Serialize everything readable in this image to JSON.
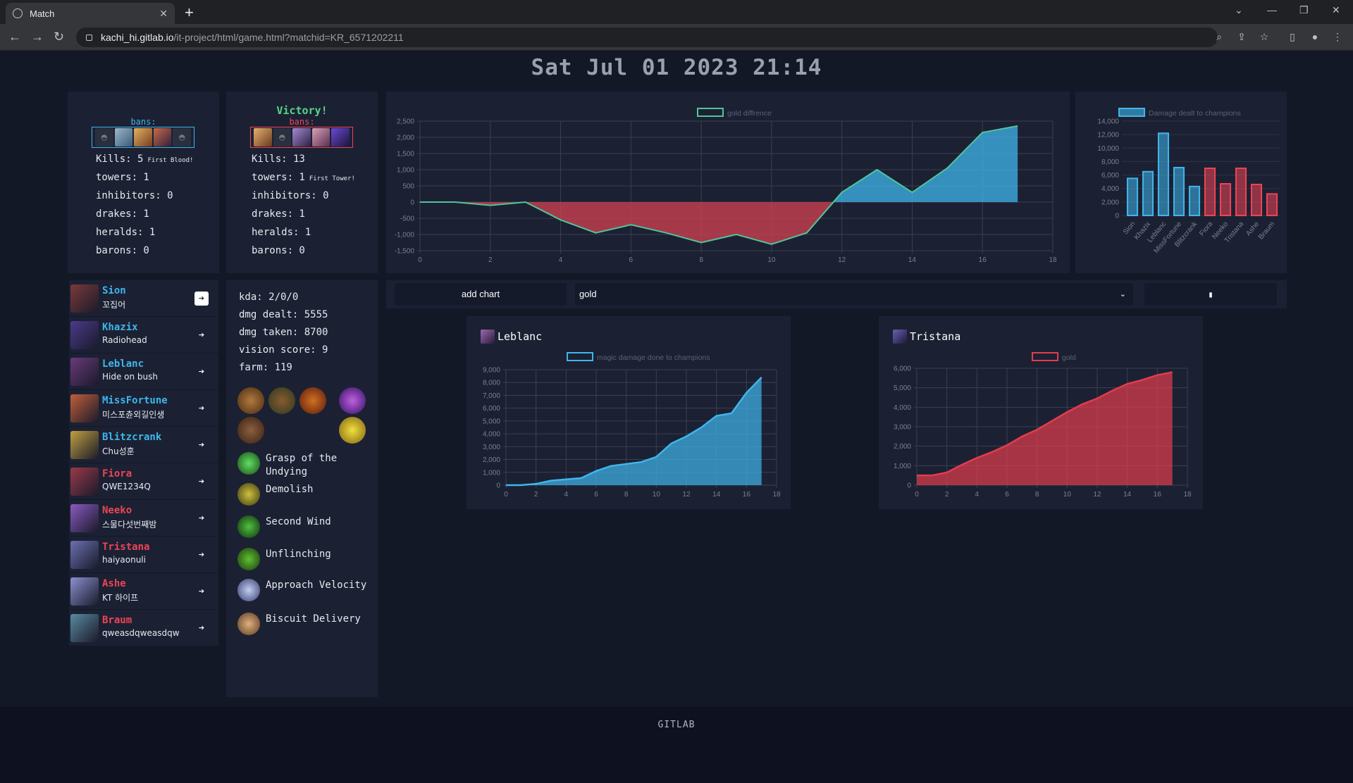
{
  "browser": {
    "tab_title": "Match",
    "url_host": "kachi_hi.gitlab.io",
    "url_path": "/it-project/html/game.html?matchid=KR_6571202211"
  },
  "page": {
    "title": "Sat Jul 01 2023 21:14",
    "footer": "GITLAB"
  },
  "teams": {
    "blue": {
      "bans_label": "bans:",
      "kills_label": "Kills: 5",
      "kills_note": "First Blood!",
      "towers": "towers: 1",
      "inhibitors": "inhibitors: 0",
      "drakes": "drakes: 1",
      "heralds": "heralds: 1",
      "barons": "barons: 0",
      "color": "#3fb6ec"
    },
    "red": {
      "result": "Victory!",
      "bans_label": "bans:",
      "kills_label": "Kills: 13",
      "towers": "towers: 1",
      "towers_note": "First Tower!",
      "inhibitors": "inhibitors: 0",
      "drakes": "drakes: 1",
      "heralds": "heralds: 1",
      "barons": "barons: 0",
      "color": "#ee4455"
    }
  },
  "players": [
    {
      "champion": "Sion",
      "player": "꼬집어",
      "team": "blue",
      "selected": true
    },
    {
      "champion": "Khazix",
      "player": "Radiohead",
      "team": "blue"
    },
    {
      "champion": "Leblanc",
      "player": "Hide on bush",
      "team": "blue"
    },
    {
      "champion": "MissFortune",
      "player": "미스포츈외길인생",
      "team": "blue"
    },
    {
      "champion": "Blitzcrank",
      "player": "Chu성훈",
      "team": "blue"
    },
    {
      "champion": "Fiora",
      "player": "QWE1234Q",
      "team": "red"
    },
    {
      "champion": "Neeko",
      "player": "스물다섯번째밤",
      "team": "red"
    },
    {
      "champion": "Tristana",
      "player": "haiyaonuli",
      "team": "red"
    },
    {
      "champion": "Ashe",
      "player": "KT 하이프",
      "team": "red"
    },
    {
      "champion": "Braum",
      "player": "qweasdqweasdqw",
      "team": "red"
    }
  ],
  "arrow_glyph": "➔",
  "selected_stats": {
    "kda": "kda: 2/0/0",
    "dmg_dealt": "dmg dealt: 5555",
    "dmg_taken": "dmg taken: 8700",
    "vision": "vision score: 9",
    "farm": "farm: 119",
    "runes": [
      "Grasp of the Undying",
      "Demolish",
      "Second Wind",
      "Unflinching",
      "Approach Velocity",
      "Biscuit Delivery"
    ]
  },
  "controls": {
    "add_chart": "add chart",
    "select_value": "gold",
    "caret": "⌄",
    "delete": "▮"
  },
  "chart_data": [
    {
      "type": "area",
      "legend": "gold diffrence",
      "x": [
        0,
        1,
        2,
        3,
        4,
        5,
        6,
        7,
        8,
        9,
        10,
        11,
        12,
        13,
        14,
        15,
        16,
        17
      ],
      "values": [
        0,
        0,
        -100,
        0,
        -550,
        -950,
        -700,
        -950,
        -1250,
        -1000,
        -1300,
        -950,
        300,
        1000,
        300,
        1050,
        2150,
        2350
      ],
      "xlim": [
        0,
        18
      ],
      "ylim": [
        -1500,
        2500
      ],
      "yticks": [
        2500,
        2000,
        1500,
        1000,
        500,
        0,
        -500,
        -1000,
        -1500
      ],
      "xticks": [
        0,
        2,
        4,
        6,
        8,
        10,
        12,
        14,
        16,
        18
      ],
      "color_positive": "#3fb6ec",
      "color_negative": "#c8404f",
      "line_color": "#52c39b"
    },
    {
      "type": "bar",
      "legend": "Damage dealt to champions",
      "categories": [
        "Sion",
        "Khazix",
        "Leblanc",
        "MissFortune",
        "Blitzcrank",
        "Fiora",
        "Neeko",
        "Tristana",
        "Ashe",
        "Braum"
      ],
      "values": [
        5500,
        6500,
        12200,
        7100,
        4300,
        7000,
        4700,
        7000,
        4600,
        3200
      ],
      "team": [
        "blue",
        "blue",
        "blue",
        "blue",
        "blue",
        "red",
        "red",
        "red",
        "red",
        "red"
      ],
      "ylim": [
        0,
        14000
      ],
      "yticks": [
        14000,
        12000,
        10000,
        8000,
        6000,
        4000,
        2000,
        0
      ]
    },
    {
      "type": "area",
      "title": "Leblanc",
      "legend": "magic damage done to champions",
      "x": [
        0,
        1,
        2,
        3,
        4,
        5,
        6,
        7,
        8,
        9,
        10,
        11,
        12,
        13,
        14,
        15,
        16,
        17
      ],
      "values": [
        0,
        0,
        100,
        350,
        450,
        550,
        1100,
        1500,
        1650,
        1800,
        2200,
        3250,
        3800,
        4500,
        5400,
        5600,
        7200,
        8400
      ],
      "xlim": [
        0,
        18
      ],
      "ylim": [
        0,
        9000
      ],
      "yticks": [
        9000,
        8000,
        7000,
        6000,
        5000,
        4000,
        3000,
        2000,
        1000,
        0
      ],
      "xticks": [
        0,
        2,
        4,
        6,
        8,
        10,
        12,
        14,
        16,
        18
      ],
      "color": "#3fb6ec"
    },
    {
      "type": "area",
      "title": "Tristana",
      "legend": "gold",
      "x": [
        0,
        1,
        2,
        3,
        4,
        5,
        6,
        7,
        8,
        9,
        10,
        11,
        12,
        13,
        14,
        15,
        16,
        17
      ],
      "values": [
        500,
        500,
        650,
        1050,
        1400,
        1700,
        2050,
        2500,
        2850,
        3300,
        3750,
        4150,
        4450,
        4850,
        5200,
        5400,
        5650,
        5800
      ],
      "xlim": [
        0,
        18
      ],
      "ylim": [
        0,
        6000
      ],
      "yticks": [
        6000,
        5000,
        4000,
        3000,
        2000,
        1000,
        0
      ],
      "xticks": [
        0,
        2,
        4,
        6,
        8,
        10,
        12,
        14,
        16,
        18
      ],
      "color": "#e23d4d"
    }
  ]
}
